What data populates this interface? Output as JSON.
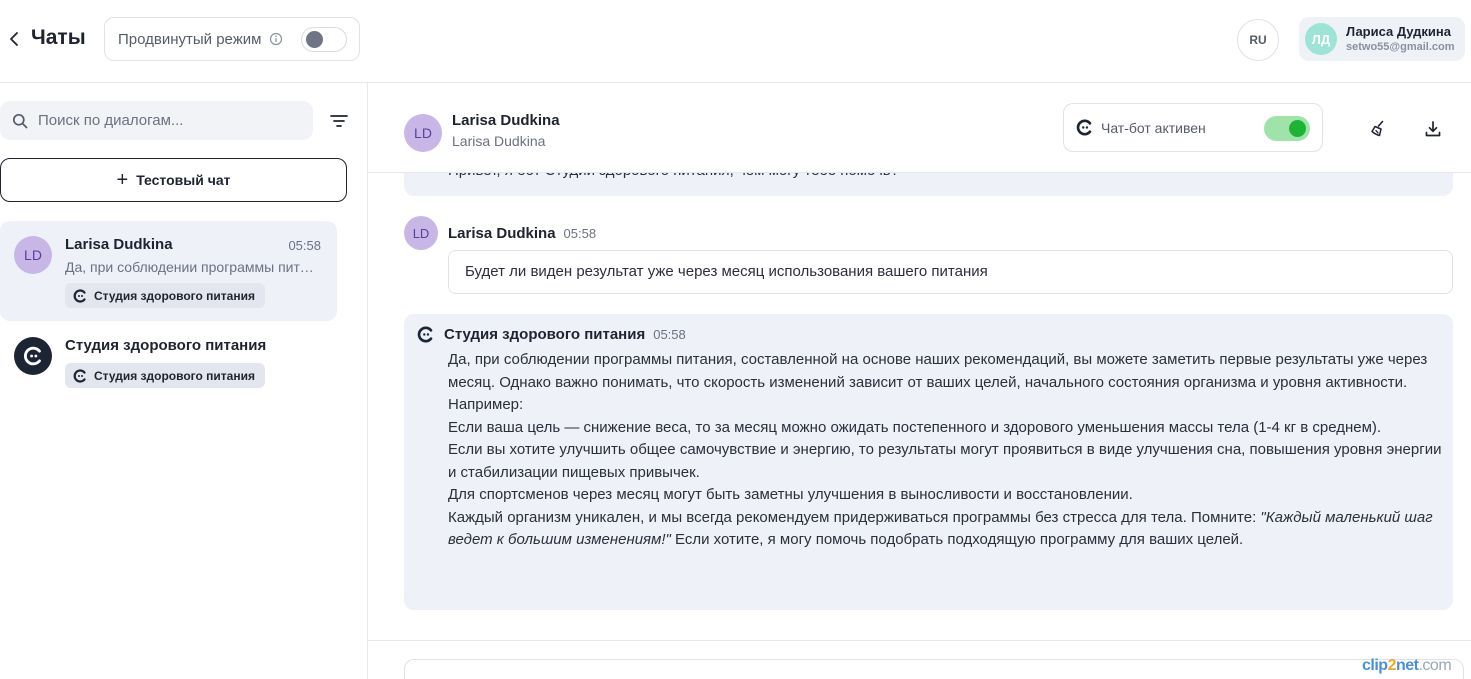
{
  "topbar": {
    "title": "Чаты",
    "advanced_mode_label": "Продвинутый режим",
    "advanced_mode_on": false,
    "language": "RU",
    "user": {
      "initials": "ЛД",
      "name": "Лариса Дудкина",
      "email": "setwo55@gmail.com"
    }
  },
  "sidebar": {
    "search_placeholder": "Поиск по диалогам...",
    "test_chat_label": "Тестовый чат",
    "dialogs": [
      {
        "initials": "LD",
        "name": "Larisa Dudkina",
        "time": "05:58",
        "preview": "Да, при соблюдении программы питания, составленной на основе наших рекомендаций",
        "tag": "Студия здорового питания",
        "active": true
      },
      {
        "name": "Студия здорового питания",
        "tag": "Студия здорового питания",
        "active": false
      }
    ]
  },
  "chat": {
    "header": {
      "initials": "LD",
      "name": "Larisa Dudkina",
      "subtitle": "Larisa Dudkina",
      "bot_label": "Чат-бот активен",
      "bot_active": true
    },
    "messages": [
      {
        "author": "bot",
        "text": "Привет, я бот Студии здорового питания, чем могу тебе помочь?"
      },
      {
        "author": "Larisa Dudkina",
        "initials": "LD",
        "time": "05:58",
        "text": "Будет ли виден результат уже через месяц использования вашего питания"
      },
      {
        "author": "Студия здорового питания",
        "time": "05:58",
        "lines": [
          "Да, при соблюдении программы питания, составленной на основе наших рекомендаций, вы можете заметить первые результаты уже через месяц. Однако важно понимать, что скорость изменений зависит от ваших целей, начального состояния организма и уровня активности.",
          "Например:",
          "Если ваша цель — снижение веса, то за месяц можно ожидать постепенного и здорового уменьшения массы тела (1-4 кг в среднем).",
          "Если вы хотите улучшить общее самочувствие и энергию, то результаты могут проявиться в виде улучшения сна, повышения уровня энергии и стабилизации пищевых привычек.",
          "Для спортсменов через месяц могут быть заметны улучшения в выносливости и восстановлении."
        ],
        "last_line_start": "Каждый организм уникален, и мы всегда рекомендуем придерживаться программы без стресса для тела. Помните: ",
        "last_line_quote": "\"Каждый маленький шаг ведет к большим изменениям!\"",
        "last_line_end": " Если хотите, я могу помочь подобрать подходящую программу для ваших целей."
      }
    ]
  },
  "watermark": {
    "text_a": "clip",
    "text_b": "2",
    "text_c": "net",
    "text_d": ".com"
  },
  "colors": {
    "accent_green": "#1db436",
    "toggle_green_bg": "#9fe3a8",
    "avatar_purple": "#c7b6e6",
    "user_avatar_teal": "#9de3d6",
    "bot_bubble_bg": "#eef1f8"
  },
  "icons": {
    "back": "chevron-left-icon",
    "info": "info-icon",
    "search": "search-icon",
    "filter": "filter-icon",
    "plus": "plus-icon",
    "bot_logo": "bot-logo-icon",
    "broom": "clear-chat-icon",
    "download": "download-icon"
  }
}
